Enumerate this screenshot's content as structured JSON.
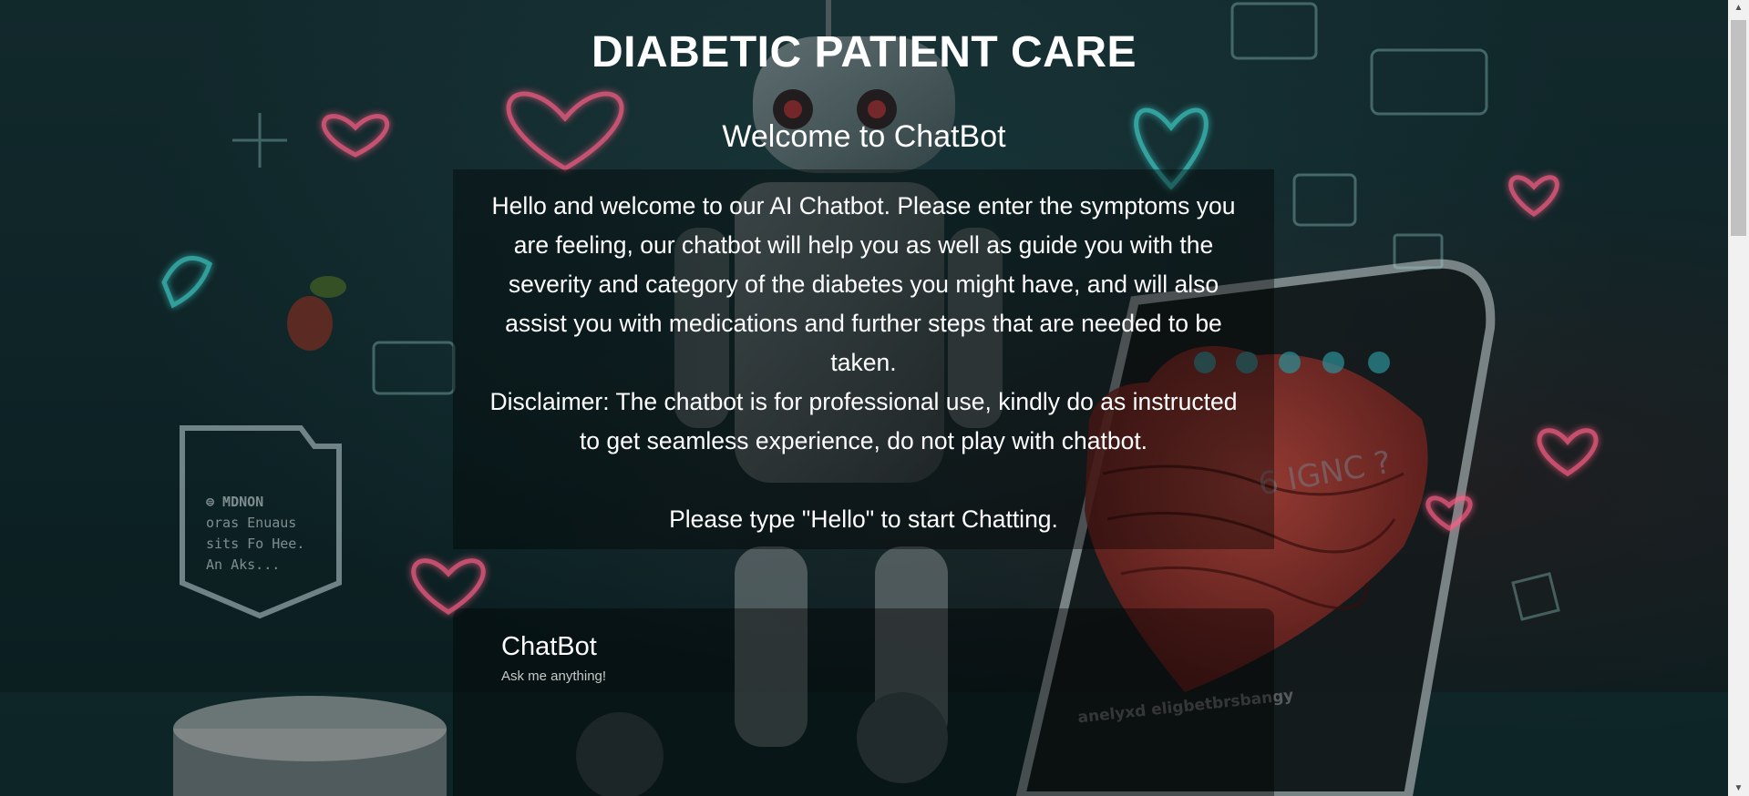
{
  "header": {
    "title": "DIABETIC PATIENT CARE",
    "welcome": "Welcome to ChatBot"
  },
  "intro": {
    "paragraph": "Hello and welcome to our AI Chatbot. Please enter the symptoms you are feeling, our chatbot will help you as well as guide you with the severity and category of the diabetes you might have, and will also assist you with medications and further steps that are needed to be taken.",
    "disclaimer": "Disclaimer: The chatbot is for professional use, kindly do as instructed to get seamless experience, do not play with chatbot.",
    "instruction": "Please type \"Hello\" to start Chatting."
  },
  "chatbot": {
    "title": "ChatBot",
    "subtitle": "Ask me anything!"
  },
  "background_sign": {
    "line1": "⊜ MDNON",
    "line2": "oras Enuaus",
    "line3": "sits Fo Hee.",
    "line4": "An Aks..."
  },
  "background_heart_text": "6 IGNC ?",
  "background_phone_text": "anelyxd eligbetbrsbangy",
  "colors": {
    "neon_pink": "#ff5f86",
    "neon_teal": "#3fd2cc",
    "panel_overlay": "rgba(0,0,0,0.38)",
    "heart_red": "#b8382f"
  }
}
